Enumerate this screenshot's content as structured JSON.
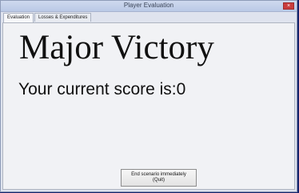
{
  "window": {
    "title": "Player Evaluation",
    "close_glyph": "×"
  },
  "tabs": [
    {
      "label": "Evaluation",
      "active": true
    },
    {
      "label": "Losses & Expenditures",
      "active": false
    }
  ],
  "evaluation": {
    "headline": "Major Victory",
    "score_text": "Your current score is:0"
  },
  "buttons": {
    "quit_line1": "End scenario immediately",
    "quit_line2": "(Quit)"
  },
  "colors": {
    "desktop": "#14236b",
    "close_button": "#c93c3c",
    "panel": "#f1f2f5"
  }
}
